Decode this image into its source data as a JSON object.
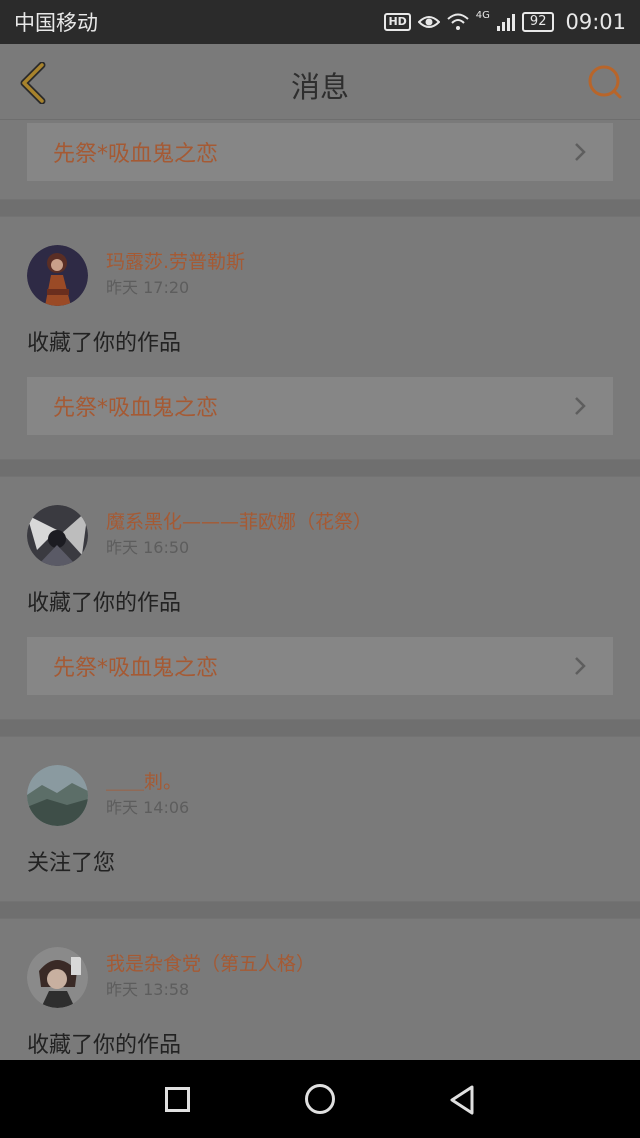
{
  "status": {
    "carrier": "中国移动",
    "hd": "HD",
    "network": "4G",
    "battery": "92",
    "time": "09:01"
  },
  "header": {
    "title": "消息",
    "back_icon": "chevron-left-icon",
    "right_icon": "chat-bubble-icon",
    "accent": "#c8702e"
  },
  "top_partial_card": {
    "work_title": "先祭*吸血鬼之恋"
  },
  "messages": [
    {
      "name": "玛露莎.劳普勒斯",
      "time": "昨天 17:20",
      "action": "收藏了你的作品",
      "work_title": "先祭*吸血鬼之恋"
    },
    {
      "name": "魔系黑化———菲欧娜（花祭）",
      "time": "昨天 16:50",
      "action": "收藏了你的作品",
      "work_title": "先祭*吸血鬼之恋"
    },
    {
      "name": "＿＿刺。",
      "time": "昨天 14:06",
      "action": "关注了您"
    },
    {
      "name": "我是杂食党（第五人格）",
      "time": "昨天 13:58",
      "action": "收藏了你的作品"
    }
  ],
  "nav": {
    "recent_icon": "square-icon",
    "home_icon": "circle-icon",
    "back_icon": "triangle-back-icon"
  }
}
